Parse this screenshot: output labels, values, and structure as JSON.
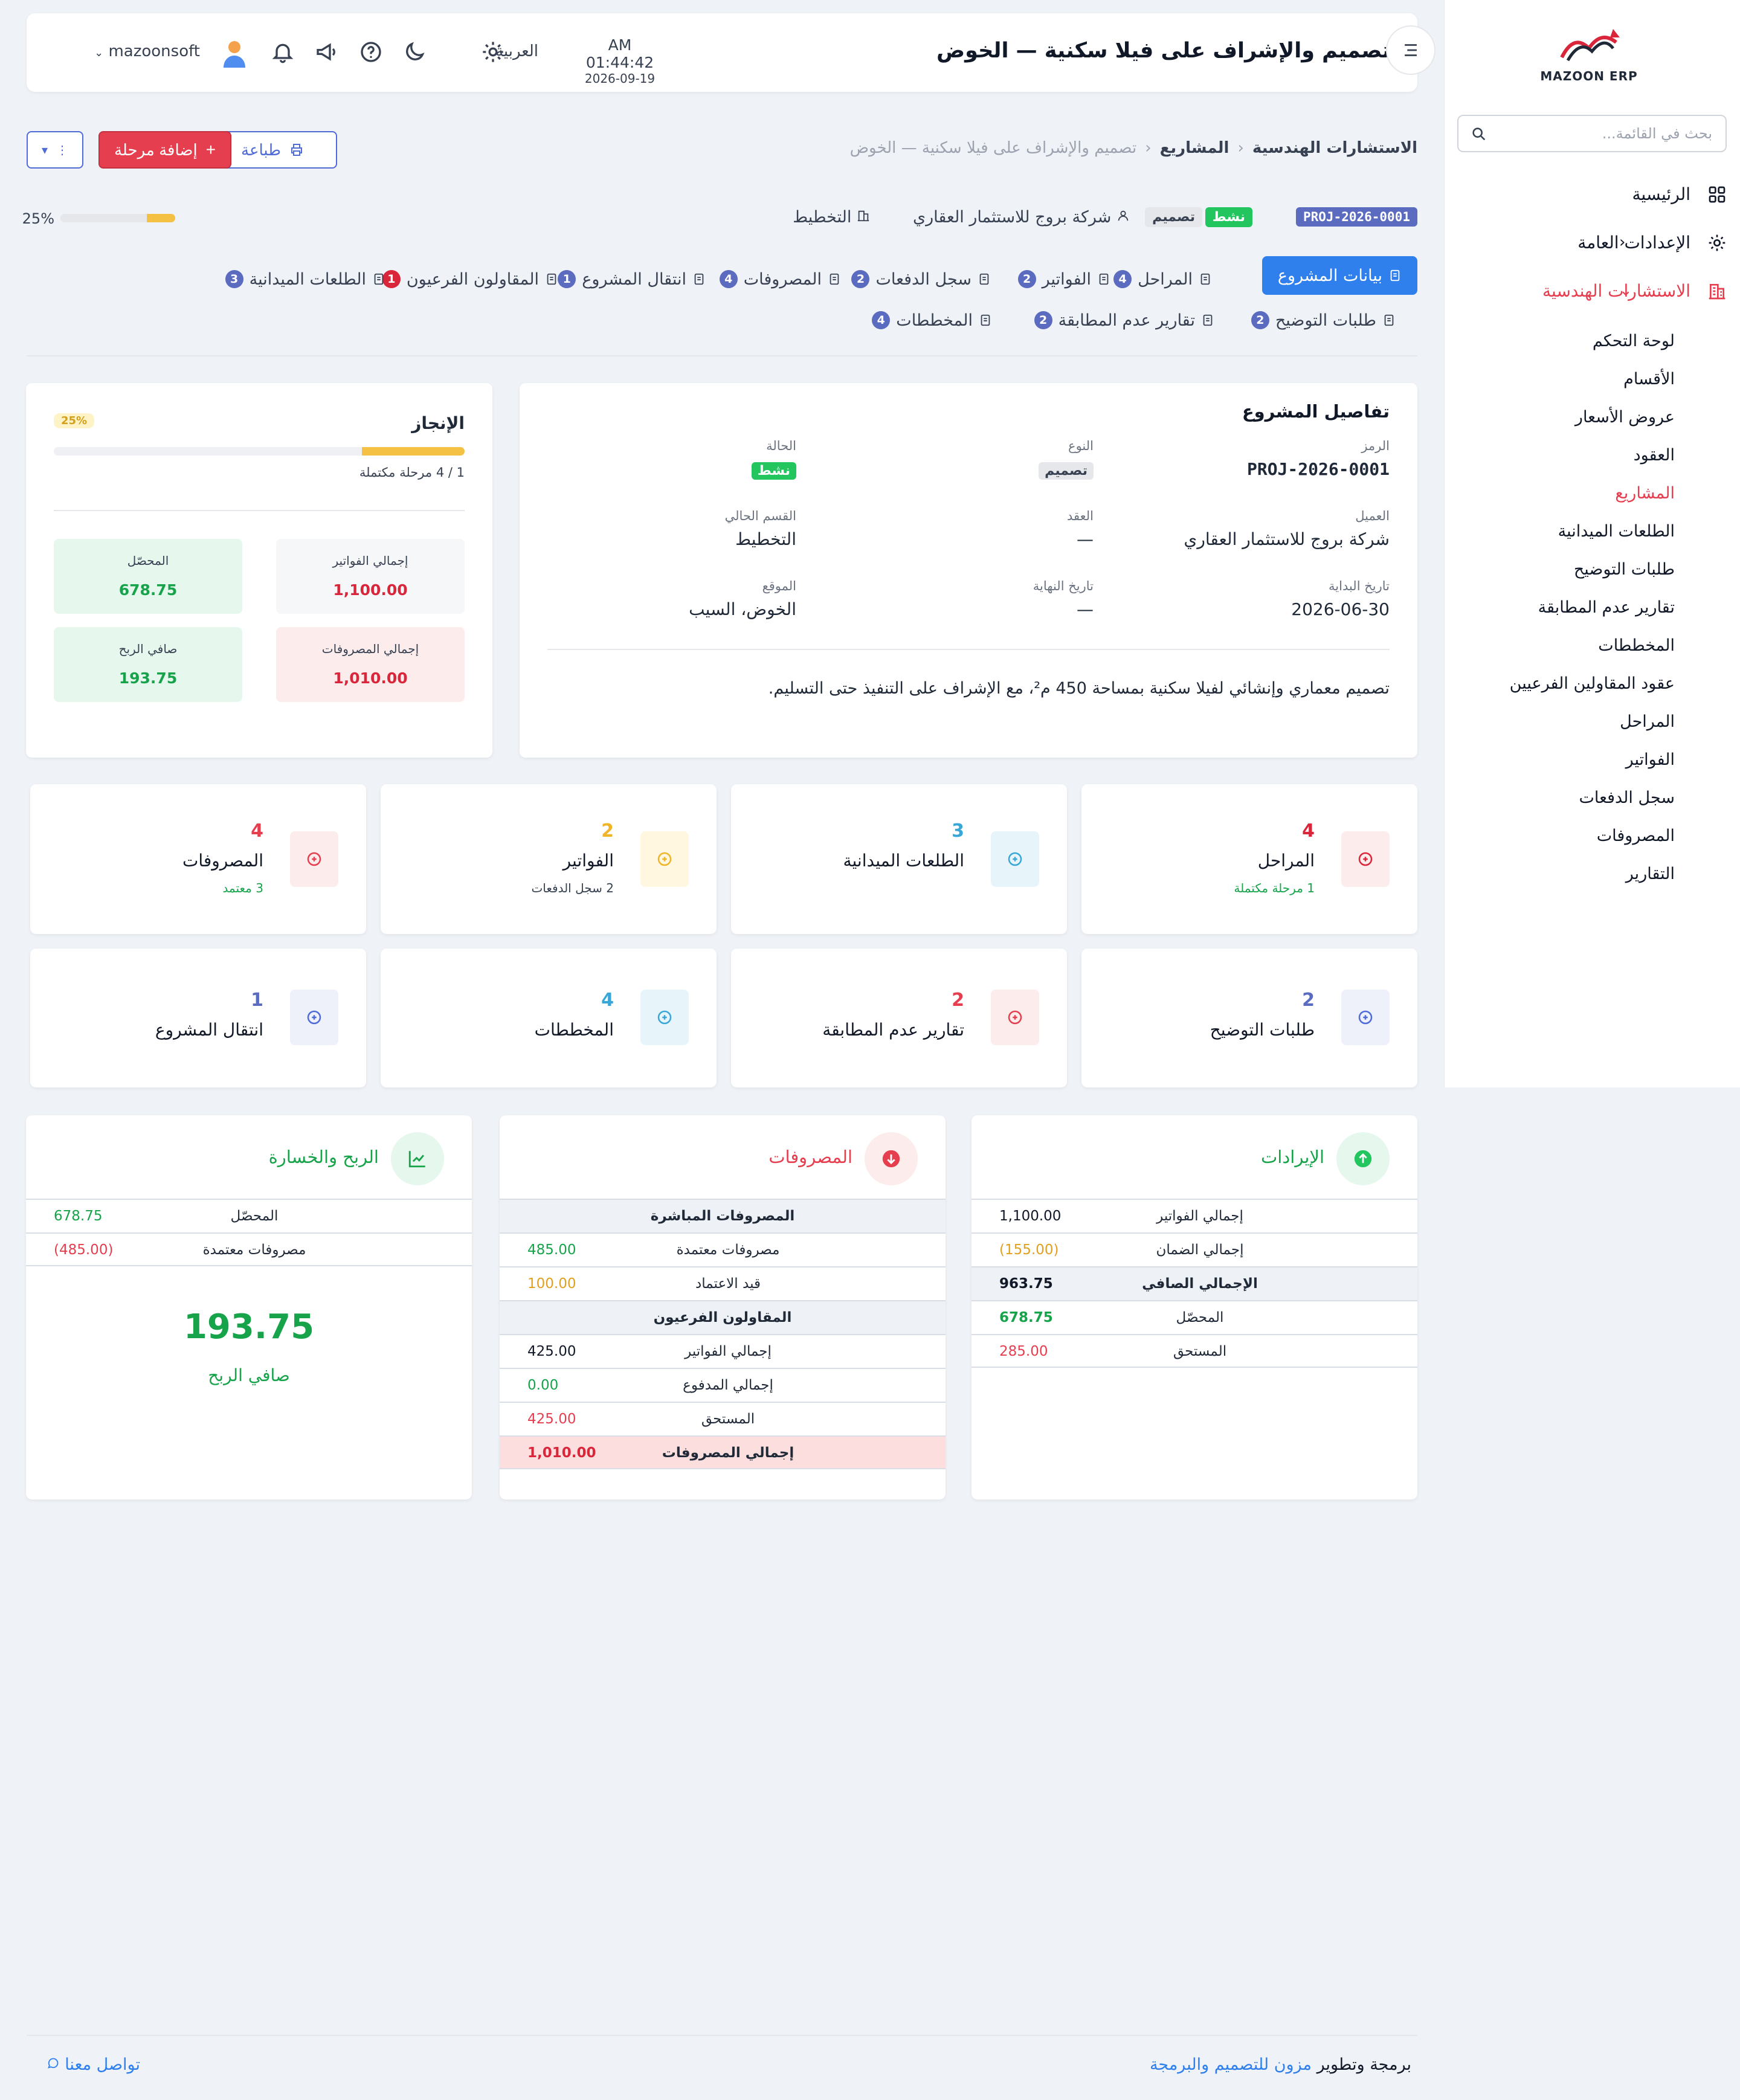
{
  "brand": {
    "logo_text": "MAZOON ERP"
  },
  "sidebar": {
    "search_placeholder": "بحث في القائمة...",
    "items": [
      {
        "label": "الرئيسية",
        "icon": "grid-icon"
      },
      {
        "label": "الإعدادات العامة",
        "icon": "gear-icon"
      },
      {
        "label": "الاستشارات الهندسية",
        "icon": "building-icon"
      }
    ],
    "sub_items": [
      "لوحة التحكم",
      "الأقسام",
      "عروض الأسعار",
      "العقود",
      "المشاريع",
      "الطلعات الميدانية",
      "طلبات التوضيح",
      "تقارير عدم المطابقة",
      "المخططات",
      "عقود المقاولين الفرعيين",
      "المراحل",
      "الفواتير",
      "سجل الدفعات",
      "المصروفات",
      "التقارير"
    ],
    "active_sub": "المشاريع"
  },
  "header": {
    "title": "تصميم والإشراف على فيلا سكنية — الخوض",
    "time": "AM 01:44:42",
    "date": "2026-09-19",
    "language": "العربية",
    "username": "mazoonsoft"
  },
  "breadcrumb": {
    "items": [
      "الاستشارات الهندسية",
      "المشاريع",
      "تصميم والإشراف على فيلا سكنية — الخوض"
    ]
  },
  "actions": {
    "print": "طباعة",
    "add_stage": "إضافة مرحلة"
  },
  "project": {
    "code": "PROJ-2026-0001",
    "status": "نشط",
    "type": "تصميم",
    "client": "شركة بروج للاستثمار العقاري",
    "department": "التخطيط",
    "progress_pct": "25%",
    "progress_value": 25
  },
  "tabs": [
    {
      "label": "بيانات المشروع",
      "count": null,
      "active": true
    },
    {
      "label": "المراحل",
      "count": "4"
    },
    {
      "label": "الفواتير",
      "count": "2"
    },
    {
      "label": "سجل الدفعات",
      "count": "2"
    },
    {
      "label": "المصروفات",
      "count": "4"
    },
    {
      "label": "انتقال المشروع",
      "count": "1"
    },
    {
      "label": "المقاولون الفرعيون",
      "count": "1"
    },
    {
      "label": "الطلعات الميدانية",
      "count": "3"
    },
    {
      "label": "طلبات التوضيح",
      "count": "2"
    },
    {
      "label": "تقارير عدم المطابقة",
      "count": "2"
    },
    {
      "label": "المخططات",
      "count": "4"
    }
  ],
  "details": {
    "title": "تفاصيل المشروع",
    "code_label": "الرمز",
    "code": "PROJ-2026-0001",
    "type_label": "النوع",
    "type": "تصميم",
    "status_label": "الحالة",
    "status": "نشط",
    "client_label": "العميل",
    "client": "شركة بروج للاستثمار العقاري",
    "contract_label": "العقد",
    "contract": "—",
    "dept_label": "القسم الحالي",
    "dept": "التخطيط",
    "start_label": "تاريخ البداية",
    "start": "2026-06-30",
    "end_label": "تاريخ النهاية",
    "end": "—",
    "location_label": "الموقع",
    "location": "الخوض، السيب",
    "description": "تصميم معماري وإنشائي لفيلا سكنية بمساحة 450 م²، مع الإشراف على التنفيذ حتى التسليم."
  },
  "progress": {
    "title": "الإنجاز",
    "pct": "25%",
    "sub": "1 / 4 مرحلة مكتملة",
    "kpis": [
      {
        "label": "إجمالي الفواتير",
        "value": "1,100.00"
      },
      {
        "label": "المحصّل",
        "value": "678.75"
      },
      {
        "label": "إجمالي المصروفات",
        "value": "1,010.00"
      },
      {
        "label": "صافي الربح",
        "value": "193.75"
      }
    ]
  },
  "stats": [
    {
      "num": "4",
      "label": "المراحل",
      "sub": "1 مرحلة مكتملة",
      "icon": "list-icon"
    },
    {
      "num": "3",
      "label": "الطلعات الميدانية",
      "sub": "",
      "icon": "location-icon"
    },
    {
      "num": "2",
      "label": "الفواتير",
      "sub": "2 سجل الدفعات",
      "icon": "invoice-icon"
    },
    {
      "num": "4",
      "label": "المصروفات",
      "sub": "3 معتمد",
      "icon": "money-icon"
    },
    {
      "num": "2",
      "label": "طلبات التوضيح",
      "sub": "",
      "icon": "chat-icon"
    },
    {
      "num": "2",
      "label": "تقارير عدم المطابقة",
      "sub": "",
      "icon": "alert-icon"
    },
    {
      "num": "4",
      "label": "المخططات",
      "sub": "",
      "icon": "drawing-icon"
    },
    {
      "num": "1",
      "label": "انتقال المشروع",
      "sub": "",
      "icon": "transfer-icon"
    }
  ],
  "revenue": {
    "title": "الإيرادات",
    "rows": [
      {
        "k": "إجمالي الفواتير",
        "v": "1,100.00"
      },
      {
        "k": "إجمالي الضمان",
        "v": "(155.00)"
      },
      {
        "k": "الإجمالي الصافي",
        "v": "963.75"
      },
      {
        "k": "المحصّل",
        "v": "678.75"
      },
      {
        "k": "المستحق",
        "v": "285.00"
      }
    ]
  },
  "expenses": {
    "title": "المصروفات",
    "sec1": "المصروفات المباشرة",
    "approved_k": "مصروفات معتمدة",
    "approved_v": "485.00",
    "pending_k": "قيد الاعتماد",
    "pending_v": "100.00",
    "sec2": "المقاولون الفرعيون",
    "inv_k": "إجمالي الفواتير",
    "inv_v": "425.00",
    "paid_k": "إجمالي المدفوع",
    "paid_v": "0.00",
    "due_k": "المستحق",
    "due_v": "425.00",
    "total_k": "إجمالي المصروفات",
    "total_v": "1,010.00"
  },
  "pnl": {
    "title": "الربح والخسارة",
    "collected_k": "المحصّل",
    "collected_v": "678.75",
    "approved_k": "مصروفات معتمدة",
    "approved_v": "(485.00)",
    "net": "193.75",
    "net_label": "صافي الربح"
  },
  "footer": {
    "prefix": "برمجة وتطوير",
    "brand": "مزون للتصميم والبرمجة",
    "contact": "تواصل معنا"
  },
  "colors": {
    "accent": "#2f80ed",
    "danger": "#e53e4f",
    "success": "#22c55e",
    "warning": "#f5c145"
  }
}
